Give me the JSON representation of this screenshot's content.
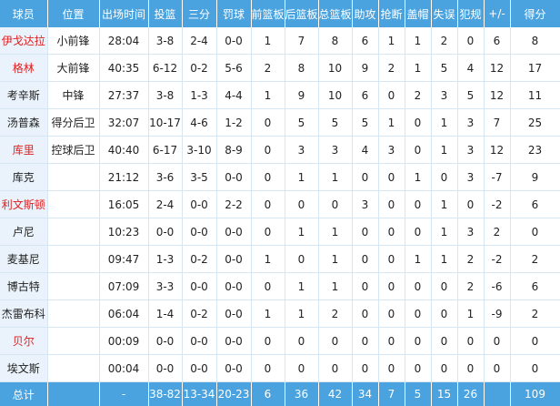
{
  "headers": [
    "球员",
    "位置",
    "出场时间",
    "投篮",
    "三分",
    "罚球",
    "前篮板",
    "后篮板",
    "总篮板",
    "助攻",
    "抢断",
    "盖帽",
    "失误",
    "犯规",
    "+/-",
    "得分"
  ],
  "rows": [
    {
      "cells": [
        "伊戈达拉",
        "小前锋",
        "28:04",
        "3-8",
        "2-4",
        "0-0",
        "1",
        "7",
        "8",
        "6",
        "1",
        "1",
        "2",
        "0",
        "6",
        "8"
      ],
      "highlight": true
    },
    {
      "cells": [
        "格林",
        "大前锋",
        "40:35",
        "6-12",
        "0-2",
        "5-6",
        "2",
        "8",
        "10",
        "9",
        "2",
        "1",
        "5",
        "4",
        "12",
        "17"
      ],
      "highlight": true
    },
    {
      "cells": [
        "考辛斯",
        "中锋",
        "27:37",
        "3-8",
        "1-3",
        "4-4",
        "1",
        "9",
        "10",
        "6",
        "0",
        "2",
        "3",
        "5",
        "12",
        "11"
      ],
      "highlight": false
    },
    {
      "cells": [
        "汤普森",
        "得分后卫",
        "32:07",
        "10-17",
        "4-6",
        "1-2",
        "0",
        "5",
        "5",
        "5",
        "1",
        "0",
        "1",
        "3",
        "7",
        "25"
      ],
      "highlight": false
    },
    {
      "cells": [
        "库里",
        "控球后卫",
        "40:40",
        "6-17",
        "3-10",
        "8-9",
        "0",
        "3",
        "3",
        "4",
        "3",
        "0",
        "1",
        "3",
        "12",
        "23"
      ],
      "highlight": true
    },
    {
      "cells": [
        "库克",
        "",
        "21:12",
        "3-6",
        "3-5",
        "0-0",
        "0",
        "1",
        "1",
        "0",
        "0",
        "1",
        "0",
        "3",
        "-7",
        "9"
      ],
      "highlight": false
    },
    {
      "cells": [
        "利文斯顿",
        "",
        "16:05",
        "2-4",
        "0-0",
        "2-2",
        "0",
        "0",
        "0",
        "3",
        "0",
        "0",
        "1",
        "0",
        "-2",
        "6"
      ],
      "highlight": true
    },
    {
      "cells": [
        "卢尼",
        "",
        "10:23",
        "0-0",
        "0-0",
        "0-0",
        "0",
        "1",
        "1",
        "0",
        "0",
        "0",
        "1",
        "3",
        "2",
        "0"
      ],
      "highlight": false
    },
    {
      "cells": [
        "麦基尼",
        "",
        "09:47",
        "1-3",
        "0-2",
        "0-0",
        "1",
        "0",
        "1",
        "0",
        "0",
        "1",
        "1",
        "2",
        "-2",
        "2"
      ],
      "highlight": false
    },
    {
      "cells": [
        "博古特",
        "",
        "07:09",
        "3-3",
        "0-0",
        "0-0",
        "0",
        "1",
        "1",
        "0",
        "0",
        "0",
        "0",
        "2",
        "-6",
        "6"
      ],
      "highlight": false
    },
    {
      "cells": [
        "杰雷布科",
        "",
        "06:04",
        "1-4",
        "0-2",
        "0-0",
        "1",
        "1",
        "2",
        "0",
        "0",
        "0",
        "0",
        "1",
        "-9",
        "2"
      ],
      "highlight": false
    },
    {
      "cells": [
        "贝尔",
        "",
        "00:09",
        "0-0",
        "0-0",
        "0-0",
        "0",
        "0",
        "0",
        "0",
        "0",
        "0",
        "0",
        "0",
        "0",
        "0"
      ],
      "highlight": true
    },
    {
      "cells": [
        "埃文斯",
        "",
        "00:04",
        "0-0",
        "0-0",
        "0-0",
        "0",
        "0",
        "0",
        "0",
        "0",
        "0",
        "0",
        "0",
        "0",
        "0"
      ],
      "highlight": false
    }
  ],
  "totals": [
    "总计",
    "",
    "-",
    "38-82",
    "13-34",
    "20-23",
    "6",
    "36",
    "42",
    "34",
    "7",
    "5",
    "15",
    "26",
    "",
    "109"
  ],
  "colors": {
    "header_bg": "#4aa3df",
    "player_cell_bg": "#eaf3fb",
    "highlight_text": "#e02020",
    "border": "#d7e6f3"
  }
}
